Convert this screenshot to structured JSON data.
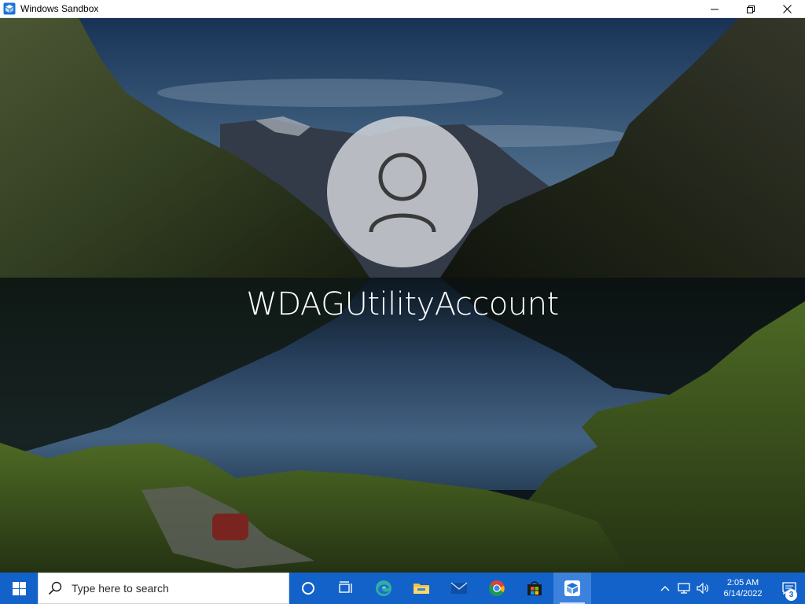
{
  "window": {
    "title": "Windows Sandbox",
    "app_icon": "sandbox-icon",
    "controls": [
      "minimize-icon",
      "maximize-icon",
      "close-icon"
    ]
  },
  "lockscreen": {
    "username": "WDAGUtilityAccount",
    "avatar_icon": "user-icon"
  },
  "taskbar": {
    "start_icon": "windows-logo-icon",
    "search": {
      "placeholder": "Type here to search"
    },
    "apps": [
      {
        "name": "cortana",
        "icon": "cortana-icon",
        "active": false
      },
      {
        "name": "task-view",
        "icon": "task-view-icon",
        "active": false
      },
      {
        "name": "edge",
        "icon": "edge-icon",
        "active": false
      },
      {
        "name": "file-explorer",
        "icon": "folder-icon",
        "active": false
      },
      {
        "name": "mail",
        "icon": "mail-icon",
        "active": false
      },
      {
        "name": "chrome",
        "icon": "chrome-icon",
        "active": false
      },
      {
        "name": "store",
        "icon": "store-icon",
        "active": false
      },
      {
        "name": "windows-sandbox",
        "icon": "sandbox-icon",
        "active": true
      }
    ],
    "tray": {
      "icons": [
        "chevron-up-icon",
        "network-icon",
        "volume-icon"
      ],
      "time": "2:05 AM",
      "date": "6/14/2022",
      "notification_count": "3"
    }
  },
  "colors": {
    "taskbar": "#1262c9",
    "active_app": "#3c82dd",
    "avatar_circle": "#d6d8dc"
  }
}
